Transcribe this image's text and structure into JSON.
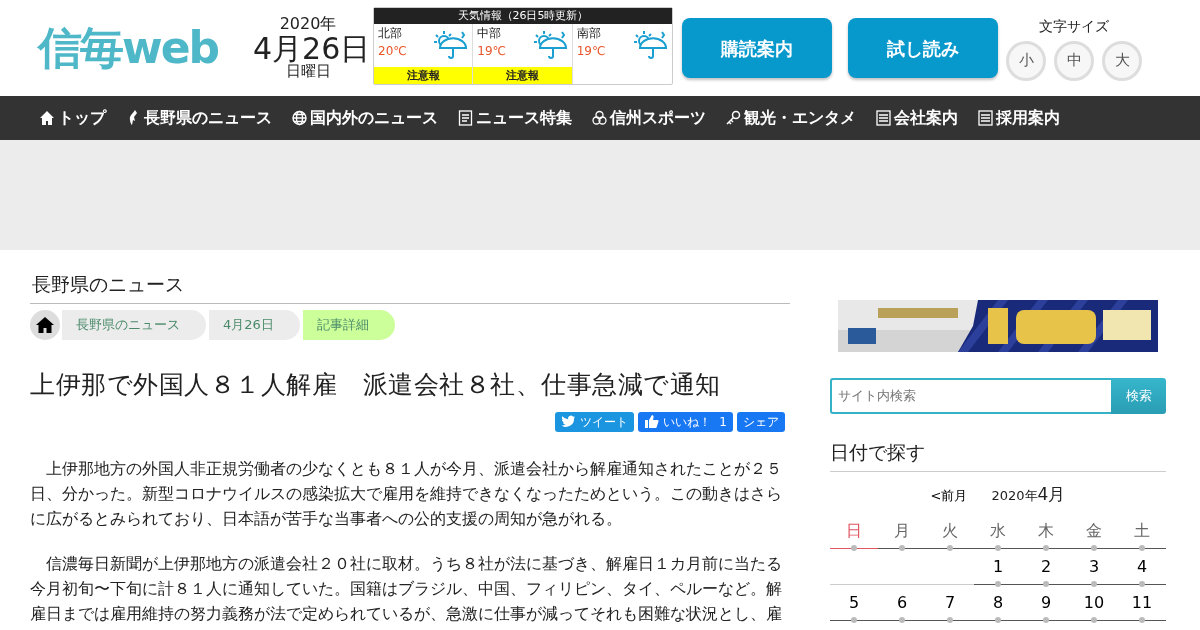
{
  "header": {
    "logo": "信毎web",
    "date": {
      "year": "2020年",
      "day": "4月26日",
      "weekday": "日曜日"
    },
    "weather": {
      "title": "天気情報（26日5時更新）",
      "regions": [
        {
          "name": "北部",
          "temp": "20℃",
          "warning": "注意報"
        },
        {
          "name": "中部",
          "temp": "19℃",
          "warning": "注意報"
        },
        {
          "name": "南部",
          "temp": "19℃"
        }
      ]
    },
    "buttons": [
      "購読案内",
      "試し読み"
    ],
    "font_size": {
      "label": "文字サイズ",
      "options": [
        "小",
        "中",
        "大"
      ]
    }
  },
  "nav": [
    {
      "label": "トップ"
    },
    {
      "label": "長野県のニュース"
    },
    {
      "label": "国内外のニュース"
    },
    {
      "label": "ニュース特集"
    },
    {
      "label": "信州スポーツ"
    },
    {
      "label": "観光・エンタメ"
    },
    {
      "label": "会社案内"
    },
    {
      "label": "採用案内"
    }
  ],
  "section_title": "長野県のニュース",
  "breadcrumb": [
    {
      "label": "長野県のニュース",
      "current": false
    },
    {
      "label": "4月26日",
      "current": false
    },
    {
      "label": "記事詳細",
      "current": true
    }
  ],
  "article": {
    "title": "上伊那で外国人８１人解雇　派遣会社８社、仕事急減で通知",
    "share": [
      {
        "kind": "twitter",
        "label": "ツイート"
      },
      {
        "kind": "like",
        "label": "いいね！",
        "count": "1"
      },
      {
        "kind": "share",
        "label": "シェア"
      }
    ],
    "paragraphs": [
      "上伊那地方の外国人非正規労働者の少なくとも８１人が今月、派遣会社から解雇通知されたことが２５日、分かった。新型コロナウイルスの感染拡大で雇用を維持できなくなったためという。この動きはさらに広がるとみられており、日本語が苦手な当事者への公的支援の周知が急がれる。",
      "信濃毎日新聞が上伊那地方の派遣会社２０社に取材。うち８社が法に基づき、解雇日１カ月前に当たる今月初旬〜下旬に計８１人に通知していた。国籍はブラジル、中国、フィリピン、タイ、ペルーなど。解雇日までは雇用維持の努力義務が法で定められているが、急激に仕事が減ってそれも困難な状況とし、雇"
    ]
  },
  "sidebar": {
    "search": {
      "placeholder": "サイト内検索",
      "button": "検索"
    },
    "calendar": {
      "title": "日付で探す",
      "prev": "<前月",
      "year": "2020年",
      "month": "4月",
      "weekdays": [
        {
          "label": "日",
          "holiday": true
        },
        {
          "label": "月",
          "holiday": false
        },
        {
          "label": "火",
          "holiday": false
        },
        {
          "label": "水",
          "holiday": false
        },
        {
          "label": "木",
          "holiday": false
        },
        {
          "label": "金",
          "holiday": false
        },
        {
          "label": "土",
          "holiday": false
        }
      ],
      "weeks": [
        [
          {
            "kind": "blank"
          },
          {
            "kind": "blank"
          },
          {
            "kind": "blank"
          },
          {
            "kind": "day",
            "label": "1"
          },
          {
            "kind": "day",
            "label": "2"
          },
          {
            "kind": "day",
            "label": "3"
          },
          {
            "kind": "day",
            "label": "4"
          }
        ],
        [
          {
            "kind": "day",
            "label": "5"
          },
          {
            "kind": "day",
            "label": "6"
          },
          {
            "kind": "day",
            "label": "7"
          },
          {
            "kind": "day",
            "label": "8"
          },
          {
            "kind": "day",
            "label": "9"
          },
          {
            "kind": "day",
            "label": "10"
          },
          {
            "kind": "day",
            "label": "11"
          }
        ]
      ]
    }
  }
}
